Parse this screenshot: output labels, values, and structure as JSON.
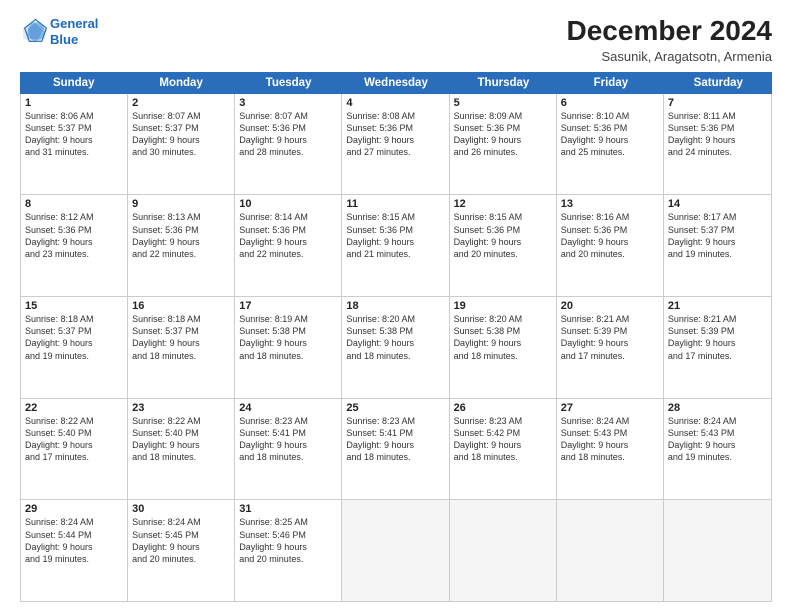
{
  "header": {
    "logo_line1": "General",
    "logo_line2": "Blue",
    "main_title": "December 2024",
    "subtitle": "Sasunik, Aragatsotn, Armenia"
  },
  "calendar": {
    "weekdays": [
      "Sunday",
      "Monday",
      "Tuesday",
      "Wednesday",
      "Thursday",
      "Friday",
      "Saturday"
    ],
    "weeks": [
      [
        {
          "day": "1",
          "sunrise": "Sunrise: 8:06 AM",
          "sunset": "Sunset: 5:37 PM",
          "daylight": "Daylight: 9 hours",
          "daylight2": "and 31 minutes."
        },
        {
          "day": "2",
          "sunrise": "Sunrise: 8:07 AM",
          "sunset": "Sunset: 5:37 PM",
          "daylight": "Daylight: 9 hours",
          "daylight2": "and 30 minutes."
        },
        {
          "day": "3",
          "sunrise": "Sunrise: 8:07 AM",
          "sunset": "Sunset: 5:36 PM",
          "daylight": "Daylight: 9 hours",
          "daylight2": "and 28 minutes."
        },
        {
          "day": "4",
          "sunrise": "Sunrise: 8:08 AM",
          "sunset": "Sunset: 5:36 PM",
          "daylight": "Daylight: 9 hours",
          "daylight2": "and 27 minutes."
        },
        {
          "day": "5",
          "sunrise": "Sunrise: 8:09 AM",
          "sunset": "Sunset: 5:36 PM",
          "daylight": "Daylight: 9 hours",
          "daylight2": "and 26 minutes."
        },
        {
          "day": "6",
          "sunrise": "Sunrise: 8:10 AM",
          "sunset": "Sunset: 5:36 PM",
          "daylight": "Daylight: 9 hours",
          "daylight2": "and 25 minutes."
        },
        {
          "day": "7",
          "sunrise": "Sunrise: 8:11 AM",
          "sunset": "Sunset: 5:36 PM",
          "daylight": "Daylight: 9 hours",
          "daylight2": "and 24 minutes."
        }
      ],
      [
        {
          "day": "8",
          "sunrise": "Sunrise: 8:12 AM",
          "sunset": "Sunset: 5:36 PM",
          "daylight": "Daylight: 9 hours",
          "daylight2": "and 23 minutes."
        },
        {
          "day": "9",
          "sunrise": "Sunrise: 8:13 AM",
          "sunset": "Sunset: 5:36 PM",
          "daylight": "Daylight: 9 hours",
          "daylight2": "and 22 minutes."
        },
        {
          "day": "10",
          "sunrise": "Sunrise: 8:14 AM",
          "sunset": "Sunset: 5:36 PM",
          "daylight": "Daylight: 9 hours",
          "daylight2": "and 22 minutes."
        },
        {
          "day": "11",
          "sunrise": "Sunrise: 8:15 AM",
          "sunset": "Sunset: 5:36 PM",
          "daylight": "Daylight: 9 hours",
          "daylight2": "and 21 minutes."
        },
        {
          "day": "12",
          "sunrise": "Sunrise: 8:15 AM",
          "sunset": "Sunset: 5:36 PM",
          "daylight": "Daylight: 9 hours",
          "daylight2": "and 20 minutes."
        },
        {
          "day": "13",
          "sunrise": "Sunrise: 8:16 AM",
          "sunset": "Sunset: 5:36 PM",
          "daylight": "Daylight: 9 hours",
          "daylight2": "and 20 minutes."
        },
        {
          "day": "14",
          "sunrise": "Sunrise: 8:17 AM",
          "sunset": "Sunset: 5:37 PM",
          "daylight": "Daylight: 9 hours",
          "daylight2": "and 19 minutes."
        }
      ],
      [
        {
          "day": "15",
          "sunrise": "Sunrise: 8:18 AM",
          "sunset": "Sunset: 5:37 PM",
          "daylight": "Daylight: 9 hours",
          "daylight2": "and 19 minutes."
        },
        {
          "day": "16",
          "sunrise": "Sunrise: 8:18 AM",
          "sunset": "Sunset: 5:37 PM",
          "daylight": "Daylight: 9 hours",
          "daylight2": "and 18 minutes."
        },
        {
          "day": "17",
          "sunrise": "Sunrise: 8:19 AM",
          "sunset": "Sunset: 5:38 PM",
          "daylight": "Daylight: 9 hours",
          "daylight2": "and 18 minutes."
        },
        {
          "day": "18",
          "sunrise": "Sunrise: 8:20 AM",
          "sunset": "Sunset: 5:38 PM",
          "daylight": "Daylight: 9 hours",
          "daylight2": "and 18 minutes."
        },
        {
          "day": "19",
          "sunrise": "Sunrise: 8:20 AM",
          "sunset": "Sunset: 5:38 PM",
          "daylight": "Daylight: 9 hours",
          "daylight2": "and 18 minutes."
        },
        {
          "day": "20",
          "sunrise": "Sunrise: 8:21 AM",
          "sunset": "Sunset: 5:39 PM",
          "daylight": "Daylight: 9 hours",
          "daylight2": "and 17 minutes."
        },
        {
          "day": "21",
          "sunrise": "Sunrise: 8:21 AM",
          "sunset": "Sunset: 5:39 PM",
          "daylight": "Daylight: 9 hours",
          "daylight2": "and 17 minutes."
        }
      ],
      [
        {
          "day": "22",
          "sunrise": "Sunrise: 8:22 AM",
          "sunset": "Sunset: 5:40 PM",
          "daylight": "Daylight: 9 hours",
          "daylight2": "and 17 minutes."
        },
        {
          "day": "23",
          "sunrise": "Sunrise: 8:22 AM",
          "sunset": "Sunset: 5:40 PM",
          "daylight": "Daylight: 9 hours",
          "daylight2": "and 18 minutes."
        },
        {
          "day": "24",
          "sunrise": "Sunrise: 8:23 AM",
          "sunset": "Sunset: 5:41 PM",
          "daylight": "Daylight: 9 hours",
          "daylight2": "and 18 minutes."
        },
        {
          "day": "25",
          "sunrise": "Sunrise: 8:23 AM",
          "sunset": "Sunset: 5:41 PM",
          "daylight": "Daylight: 9 hours",
          "daylight2": "and 18 minutes."
        },
        {
          "day": "26",
          "sunrise": "Sunrise: 8:23 AM",
          "sunset": "Sunset: 5:42 PM",
          "daylight": "Daylight: 9 hours",
          "daylight2": "and 18 minutes."
        },
        {
          "day": "27",
          "sunrise": "Sunrise: 8:24 AM",
          "sunset": "Sunset: 5:43 PM",
          "daylight": "Daylight: 9 hours",
          "daylight2": "and 18 minutes."
        },
        {
          "day": "28",
          "sunrise": "Sunrise: 8:24 AM",
          "sunset": "Sunset: 5:43 PM",
          "daylight": "Daylight: 9 hours",
          "daylight2": "and 19 minutes."
        }
      ],
      [
        {
          "day": "29",
          "sunrise": "Sunrise: 8:24 AM",
          "sunset": "Sunset: 5:44 PM",
          "daylight": "Daylight: 9 hours",
          "daylight2": "and 19 minutes."
        },
        {
          "day": "30",
          "sunrise": "Sunrise: 8:24 AM",
          "sunset": "Sunset: 5:45 PM",
          "daylight": "Daylight: 9 hours",
          "daylight2": "and 20 minutes."
        },
        {
          "day": "31",
          "sunrise": "Sunrise: 8:25 AM",
          "sunset": "Sunset: 5:46 PM",
          "daylight": "Daylight: 9 hours",
          "daylight2": "and 20 minutes."
        },
        {
          "day": "",
          "sunrise": "",
          "sunset": "",
          "daylight": "",
          "daylight2": ""
        },
        {
          "day": "",
          "sunrise": "",
          "sunset": "",
          "daylight": "",
          "daylight2": ""
        },
        {
          "day": "",
          "sunrise": "",
          "sunset": "",
          "daylight": "",
          "daylight2": ""
        },
        {
          "day": "",
          "sunrise": "",
          "sunset": "",
          "daylight": "",
          "daylight2": ""
        }
      ]
    ]
  }
}
